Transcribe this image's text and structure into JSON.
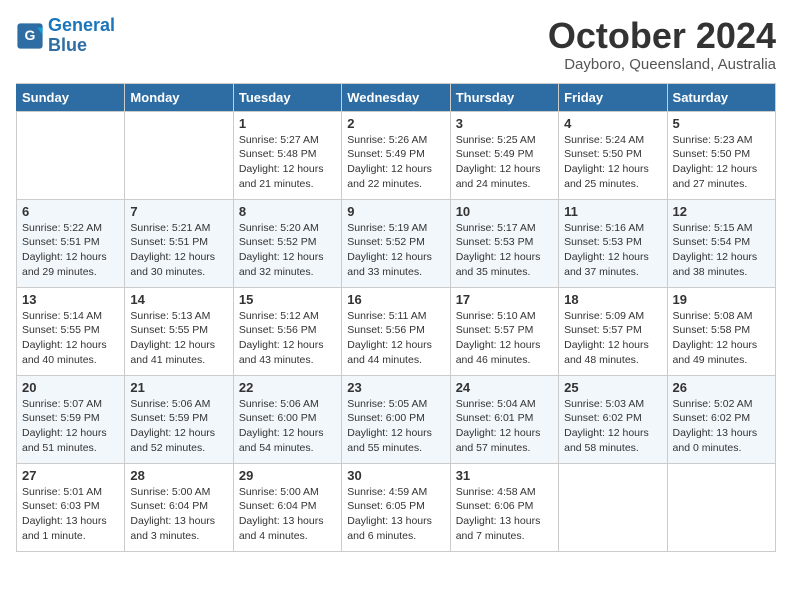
{
  "header": {
    "logo_line1": "General",
    "logo_line2": "Blue",
    "month": "October 2024",
    "location": "Dayboro, Queensland, Australia"
  },
  "days_of_week": [
    "Sunday",
    "Monday",
    "Tuesday",
    "Wednesday",
    "Thursday",
    "Friday",
    "Saturday"
  ],
  "weeks": [
    [
      {
        "day": "",
        "info": ""
      },
      {
        "day": "",
        "info": ""
      },
      {
        "day": "1",
        "info": "Sunrise: 5:27 AM\nSunset: 5:48 PM\nDaylight: 12 hours and 21 minutes."
      },
      {
        "day": "2",
        "info": "Sunrise: 5:26 AM\nSunset: 5:49 PM\nDaylight: 12 hours and 22 minutes."
      },
      {
        "day": "3",
        "info": "Sunrise: 5:25 AM\nSunset: 5:49 PM\nDaylight: 12 hours and 24 minutes."
      },
      {
        "day": "4",
        "info": "Sunrise: 5:24 AM\nSunset: 5:50 PM\nDaylight: 12 hours and 25 minutes."
      },
      {
        "day": "5",
        "info": "Sunrise: 5:23 AM\nSunset: 5:50 PM\nDaylight: 12 hours and 27 minutes."
      }
    ],
    [
      {
        "day": "6",
        "info": "Sunrise: 5:22 AM\nSunset: 5:51 PM\nDaylight: 12 hours and 29 minutes."
      },
      {
        "day": "7",
        "info": "Sunrise: 5:21 AM\nSunset: 5:51 PM\nDaylight: 12 hours and 30 minutes."
      },
      {
        "day": "8",
        "info": "Sunrise: 5:20 AM\nSunset: 5:52 PM\nDaylight: 12 hours and 32 minutes."
      },
      {
        "day": "9",
        "info": "Sunrise: 5:19 AM\nSunset: 5:52 PM\nDaylight: 12 hours and 33 minutes."
      },
      {
        "day": "10",
        "info": "Sunrise: 5:17 AM\nSunset: 5:53 PM\nDaylight: 12 hours and 35 minutes."
      },
      {
        "day": "11",
        "info": "Sunrise: 5:16 AM\nSunset: 5:53 PM\nDaylight: 12 hours and 37 minutes."
      },
      {
        "day": "12",
        "info": "Sunrise: 5:15 AM\nSunset: 5:54 PM\nDaylight: 12 hours and 38 minutes."
      }
    ],
    [
      {
        "day": "13",
        "info": "Sunrise: 5:14 AM\nSunset: 5:55 PM\nDaylight: 12 hours and 40 minutes."
      },
      {
        "day": "14",
        "info": "Sunrise: 5:13 AM\nSunset: 5:55 PM\nDaylight: 12 hours and 41 minutes."
      },
      {
        "day": "15",
        "info": "Sunrise: 5:12 AM\nSunset: 5:56 PM\nDaylight: 12 hours and 43 minutes."
      },
      {
        "day": "16",
        "info": "Sunrise: 5:11 AM\nSunset: 5:56 PM\nDaylight: 12 hours and 44 minutes."
      },
      {
        "day": "17",
        "info": "Sunrise: 5:10 AM\nSunset: 5:57 PM\nDaylight: 12 hours and 46 minutes."
      },
      {
        "day": "18",
        "info": "Sunrise: 5:09 AM\nSunset: 5:57 PM\nDaylight: 12 hours and 48 minutes."
      },
      {
        "day": "19",
        "info": "Sunrise: 5:08 AM\nSunset: 5:58 PM\nDaylight: 12 hours and 49 minutes."
      }
    ],
    [
      {
        "day": "20",
        "info": "Sunrise: 5:07 AM\nSunset: 5:59 PM\nDaylight: 12 hours and 51 minutes."
      },
      {
        "day": "21",
        "info": "Sunrise: 5:06 AM\nSunset: 5:59 PM\nDaylight: 12 hours and 52 minutes."
      },
      {
        "day": "22",
        "info": "Sunrise: 5:06 AM\nSunset: 6:00 PM\nDaylight: 12 hours and 54 minutes."
      },
      {
        "day": "23",
        "info": "Sunrise: 5:05 AM\nSunset: 6:00 PM\nDaylight: 12 hours and 55 minutes."
      },
      {
        "day": "24",
        "info": "Sunrise: 5:04 AM\nSunset: 6:01 PM\nDaylight: 12 hours and 57 minutes."
      },
      {
        "day": "25",
        "info": "Sunrise: 5:03 AM\nSunset: 6:02 PM\nDaylight: 12 hours and 58 minutes."
      },
      {
        "day": "26",
        "info": "Sunrise: 5:02 AM\nSunset: 6:02 PM\nDaylight: 13 hours and 0 minutes."
      }
    ],
    [
      {
        "day": "27",
        "info": "Sunrise: 5:01 AM\nSunset: 6:03 PM\nDaylight: 13 hours and 1 minute."
      },
      {
        "day": "28",
        "info": "Sunrise: 5:00 AM\nSunset: 6:04 PM\nDaylight: 13 hours and 3 minutes."
      },
      {
        "day": "29",
        "info": "Sunrise: 5:00 AM\nSunset: 6:04 PM\nDaylight: 13 hours and 4 minutes."
      },
      {
        "day": "30",
        "info": "Sunrise: 4:59 AM\nSunset: 6:05 PM\nDaylight: 13 hours and 6 minutes."
      },
      {
        "day": "31",
        "info": "Sunrise: 4:58 AM\nSunset: 6:06 PM\nDaylight: 13 hours and 7 minutes."
      },
      {
        "day": "",
        "info": ""
      },
      {
        "day": "",
        "info": ""
      }
    ]
  ]
}
